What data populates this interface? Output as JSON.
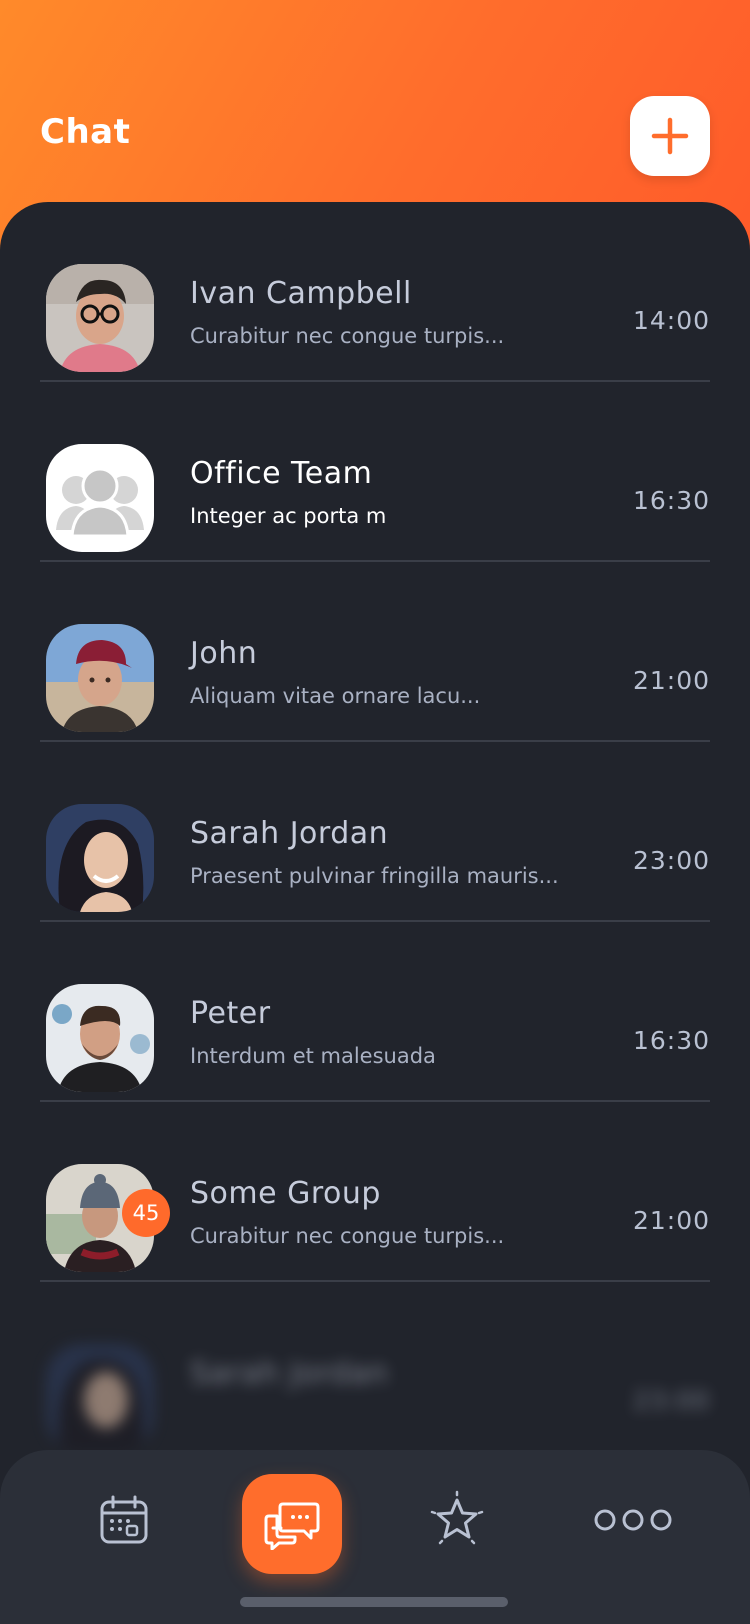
{
  "header": {
    "title": "Chat"
  },
  "chats": [
    {
      "name": "Ivan Campbell",
      "preview": "Curabitur nec congue turpis...",
      "time": "14:00",
      "avatar": "avatar-ivan"
    },
    {
      "name": "Office Team",
      "preview": "Integer ac porta m",
      "time": "16:30",
      "avatar": "group-placeholder-icon"
    },
    {
      "name": "John",
      "preview": "Aliquam vitae ornare lacu...",
      "time": "21:00",
      "avatar": "avatar-john"
    },
    {
      "name": "Sarah Jordan",
      "preview": "Praesent pulvinar fringilla mauris...",
      "time": "23:00",
      "avatar": "avatar-sarah"
    },
    {
      "name": "Peter",
      "preview": "Interdum et malesuada",
      "time": "16:30",
      "avatar": "avatar-peter"
    },
    {
      "name": "Some Group",
      "preview": "Curabitur nec congue turpis...",
      "time": "21:00",
      "avatar": "avatar-some-group",
      "badge": "45"
    },
    {
      "name": "Sarah Jordan",
      "preview": "",
      "time": "23:00",
      "avatar": "avatar-sarah"
    }
  ],
  "tabbar": {
    "items": [
      "calendar-icon",
      "chat-bubbles-icon",
      "star-icon",
      "more-dots-icon"
    ],
    "active": "chat-bubbles-icon"
  },
  "colors": {
    "accent": "#ff6d2c",
    "background": "#21242c",
    "tabbar": "#2b2f38"
  }
}
